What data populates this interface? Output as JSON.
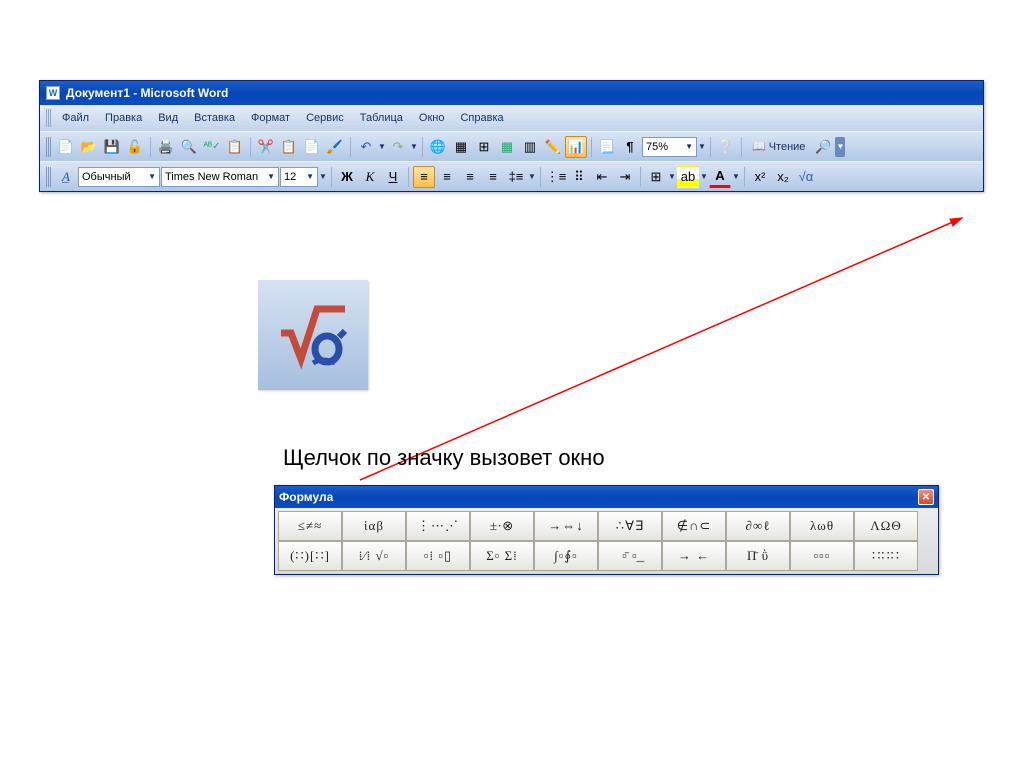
{
  "window": {
    "title": "Документ1 - Microsoft Word"
  },
  "menu": [
    "Файл",
    "Правка",
    "Вид",
    "Вставка",
    "Формат",
    "Сервис",
    "Таблица",
    "Окно",
    "Справка"
  ],
  "standard_toolbar": {
    "zoom": "75%",
    "read": "Чтение"
  },
  "formatting_toolbar": {
    "style": "Обычный",
    "font": "Times New Roman",
    "size": "12",
    "bold": "Ж",
    "italic": "К",
    "underline": "Ч",
    "super": "x²",
    "sub": "x₂",
    "equation": "√α"
  },
  "caption": "Щелчок по значку вызовет окно",
  "formula": {
    "title": "Формула",
    "row1": [
      "≤≠≈",
      "ἱαβ",
      "⋮⋯⋰",
      "±∙⊗",
      "→⇔↓",
      "∴∀∃",
      "∉∩⊂",
      "∂∞ℓ",
      "λωθ",
      "ΛΩΘ"
    ],
    "row2": [
      "(∷)[∷]",
      "⁞⁄⁞ √▫",
      "▫⁞ ▫▯",
      "Σ▫ Σ⁞",
      "∫▫∮▫",
      "▫̄ ▫͟",
      "→ ←",
      "Π̄ ῢ",
      "▫▫▫",
      "∷∷∷"
    ]
  }
}
